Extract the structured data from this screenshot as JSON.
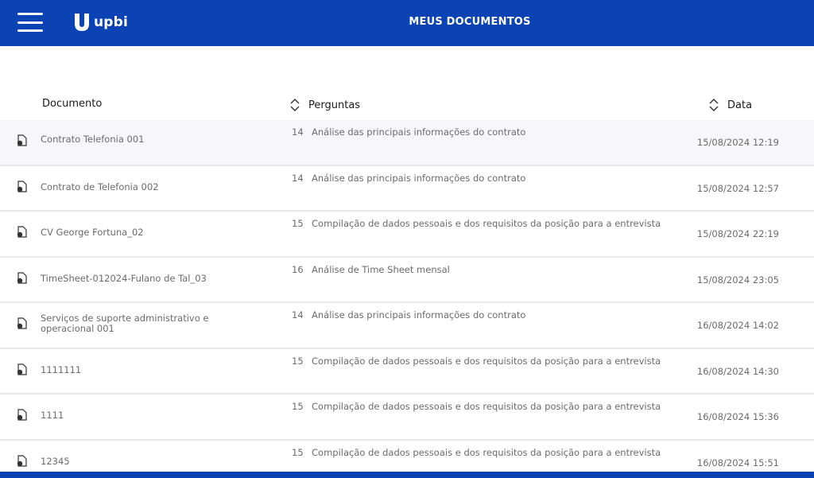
{
  "header": {
    "brand": "upbi",
    "title": "MEUS DOCUMENTOS",
    "menu_icon": "hamburger-menu-icon",
    "logo_icon": "upbi-logo-icon"
  },
  "table": {
    "columns": {
      "documento": "Documento",
      "perguntas": "Perguntas",
      "data": "Data"
    },
    "rows": [
      {
        "documento": "Contrato Telefonia 001",
        "perguntas_num": "14",
        "perguntas": "Análise das principais informações do contrato",
        "data": "15/08/2024 12:19"
      },
      {
        "documento": "Contrato de Telefonia 002",
        "perguntas_num": "14",
        "perguntas": "Análise das principais informações do contrato",
        "data": "15/08/2024 12:57"
      },
      {
        "documento": "CV George Fortuna_02",
        "perguntas_num": "15",
        "perguntas": "Compilação de dados pessoais e dos requisitos da posição para a entrevista",
        "data": "15/08/2024 22:19"
      },
      {
        "documento": "TimeSheet-012024-Fulano de Tal_03",
        "perguntas_num": "16",
        "perguntas": "Análise de Time Sheet mensal",
        "data": "15/08/2024 23:05"
      },
      {
        "documento": "Serviços de suporte administrativo e operacional 001",
        "perguntas_num": "14",
        "perguntas": "Análise das principais informações do contrato",
        "data": "16/08/2024 14:02"
      },
      {
        "documento": "1111111",
        "perguntas_num": "15",
        "perguntas": "Compilação de dados pessoais e dos requisitos da posição para a entrevista",
        "data": "16/08/2024 14:30"
      },
      {
        "documento": "1111",
        "perguntas_num": "15",
        "perguntas": "Compilação de dados pessoais e dos requisitos da posição para a entrevista",
        "data": "16/08/2024 15:36"
      },
      {
        "documento": "12345",
        "perguntas_num": "15",
        "perguntas": "Compilação de dados pessoais e dos requisitos da posição para a entrevista",
        "data": "16/08/2024 15:51"
      }
    ]
  },
  "colors": {
    "brand_blue": "#0b43b4",
    "text_muted": "#6b6b6b",
    "row_highlight": "#f5f7fb"
  }
}
